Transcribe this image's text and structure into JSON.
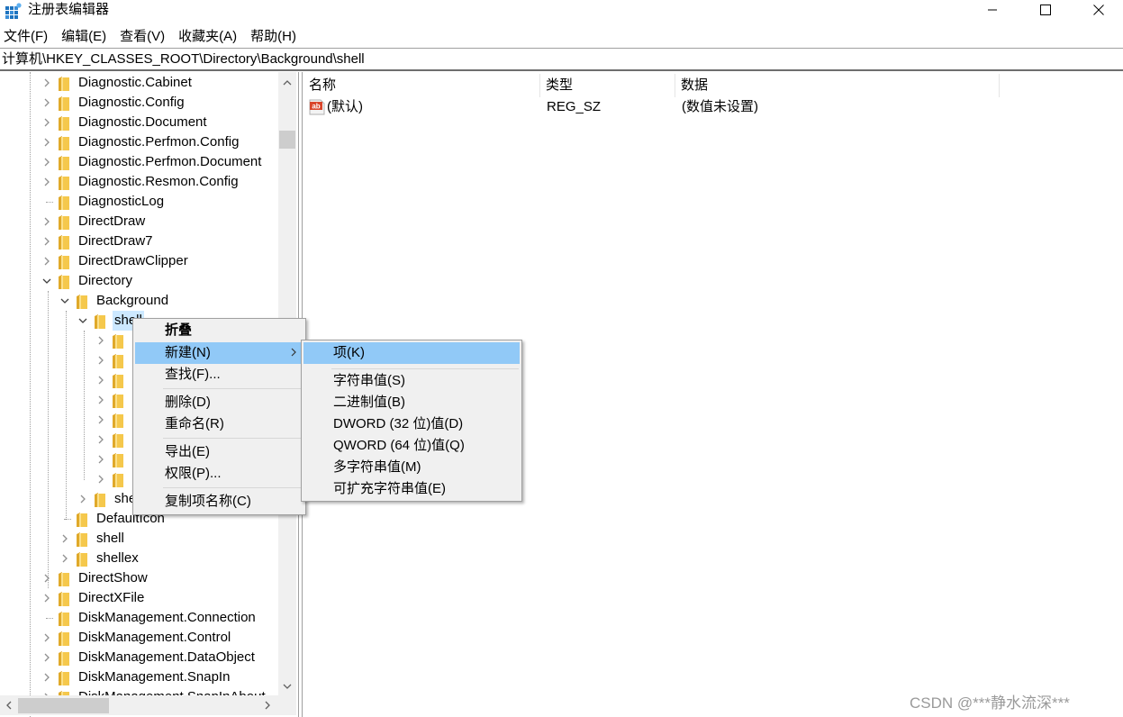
{
  "window": {
    "title": "注册表编辑器",
    "controls": {
      "minimize": "minimize",
      "maximize": "maximize",
      "close": "close"
    }
  },
  "menubar": [
    "文件(F)",
    "编辑(E)",
    "查看(V)",
    "收藏夹(A)",
    "帮助(H)"
  ],
  "address": "计算机\\HKEY_CLASSES_ROOT\\Directory\\Background\\shell",
  "tree": {
    "items": [
      {
        "label": "Diagnostic.Cabinet",
        "level": 0,
        "expander": "collapsed"
      },
      {
        "label": "Diagnostic.Config",
        "level": 0,
        "expander": "collapsed"
      },
      {
        "label": "Diagnostic.Document",
        "level": 0,
        "expander": "collapsed"
      },
      {
        "label": "Diagnostic.Perfmon.Config",
        "level": 0,
        "expander": "collapsed"
      },
      {
        "label": "Diagnostic.Perfmon.Document",
        "level": 0,
        "expander": "collapsed"
      },
      {
        "label": "Diagnostic.Resmon.Config",
        "level": 0,
        "expander": "collapsed"
      },
      {
        "label": "DiagnosticLog",
        "level": 0,
        "expander": "none"
      },
      {
        "label": "DirectDraw",
        "level": 0,
        "expander": "collapsed"
      },
      {
        "label": "DirectDraw7",
        "level": 0,
        "expander": "collapsed"
      },
      {
        "label": "DirectDrawClipper",
        "level": 0,
        "expander": "collapsed"
      },
      {
        "label": "Directory",
        "level": 0,
        "expander": "expanded"
      },
      {
        "label": "Background",
        "level": 1,
        "expander": "expanded"
      },
      {
        "label": "shell",
        "level": 2,
        "expander": "expanded",
        "selected": true
      },
      {
        "label": "",
        "level": 3,
        "expander": "collapsed"
      },
      {
        "label": "",
        "level": 3,
        "expander": "collapsed"
      },
      {
        "label": "",
        "level": 3,
        "expander": "collapsed"
      },
      {
        "label": "",
        "level": 3,
        "expander": "collapsed"
      },
      {
        "label": "",
        "level": 3,
        "expander": "collapsed"
      },
      {
        "label": "",
        "level": 3,
        "expander": "collapsed"
      },
      {
        "label": "",
        "level": 3,
        "expander": "collapsed"
      },
      {
        "label": "",
        "level": 3,
        "expander": "collapsed"
      },
      {
        "label": "shellex",
        "level": 2,
        "expander": "collapsed"
      },
      {
        "label": "DefaultIcon",
        "level": 1,
        "expander": "none"
      },
      {
        "label": "shell",
        "level": 1,
        "expander": "collapsed"
      },
      {
        "label": "shellex",
        "level": 1,
        "expander": "collapsed"
      },
      {
        "label": "DirectShow",
        "level": 0,
        "expander": "collapsed"
      },
      {
        "label": "DirectXFile",
        "level": 0,
        "expander": "collapsed"
      },
      {
        "label": "DiskManagement.Connection",
        "level": 0,
        "expander": "none"
      },
      {
        "label": "DiskManagement.Control",
        "level": 0,
        "expander": "collapsed"
      },
      {
        "label": "DiskManagement.DataObject",
        "level": 0,
        "expander": "collapsed"
      },
      {
        "label": "DiskManagement.SnapIn",
        "level": 0,
        "expander": "collapsed"
      },
      {
        "label": "DiskManagement.SnapInAbout",
        "level": 0,
        "expander": "collapsed"
      }
    ]
  },
  "list": {
    "columns": [
      "名称",
      "类型",
      "数据"
    ],
    "rows": [
      {
        "name": "(默认)",
        "type": "REG_SZ",
        "data": "(数值未设置)",
        "icon": "string-value-icon"
      }
    ]
  },
  "context_menu": {
    "items": [
      {
        "label": "折叠",
        "bold": true
      },
      {
        "label": "新建(N)",
        "submenu": true,
        "highlighted": true
      },
      {
        "label": "查找(F)..."
      },
      {
        "separator": true
      },
      {
        "label": "删除(D)"
      },
      {
        "label": "重命名(R)"
      },
      {
        "separator": true
      },
      {
        "label": "导出(E)"
      },
      {
        "label": "权限(P)..."
      },
      {
        "separator": true
      },
      {
        "label": "复制项名称(C)"
      }
    ]
  },
  "submenu": {
    "items": [
      {
        "label": "项(K)",
        "highlighted": true
      },
      {
        "separator": true
      },
      {
        "label": "字符串值(S)"
      },
      {
        "label": "二进制值(B)"
      },
      {
        "label": "DWORD (32 位)值(D)"
      },
      {
        "label": "QWORD (64 位)值(Q)"
      },
      {
        "label": "多字符串值(M)"
      },
      {
        "label": "可扩充字符串值(E)"
      }
    ]
  },
  "watermark": "CSDN @***静水流深***",
  "colors": {
    "selection": "#cce8ff",
    "menu_highlight": "#91c9f7",
    "folder": "#f5c84c",
    "menu_bg": "#f0f0f0"
  }
}
